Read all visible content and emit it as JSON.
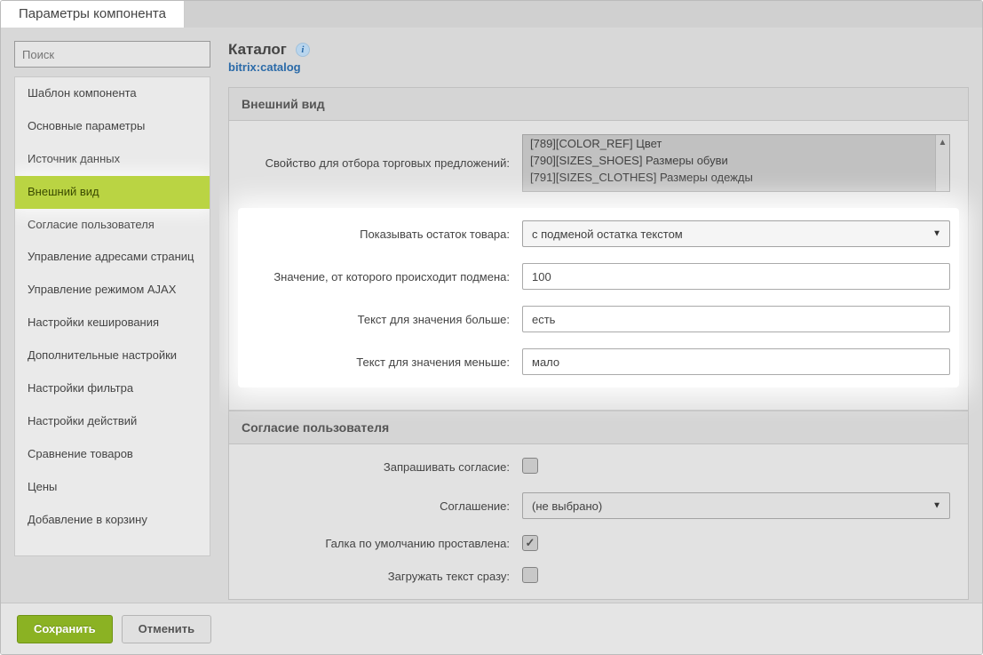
{
  "header": {
    "tab_title": "Параметры компонента"
  },
  "sidebar": {
    "search_placeholder": "Поиск",
    "items": [
      {
        "label": "Шаблон компонента"
      },
      {
        "label": "Основные параметры"
      },
      {
        "label": "Источник данных"
      },
      {
        "label": "Внешний вид",
        "active": true
      },
      {
        "label": "Согласие пользователя"
      },
      {
        "label": "Управление адресами страниц"
      },
      {
        "label": "Управление режимом AJAX"
      },
      {
        "label": "Настройки кеширования"
      },
      {
        "label": "Дополнительные настройки"
      },
      {
        "label": "Настройки фильтра"
      },
      {
        "label": "Настройки действий"
      },
      {
        "label": "Сравнение товаров"
      },
      {
        "label": "Цены"
      },
      {
        "label": "Добавление в корзину"
      }
    ]
  },
  "page": {
    "title": "Каталог",
    "component_name": "bitrix:catalog"
  },
  "section_appearance": {
    "title": "Внешний вид",
    "offer_prop_label": "Свойство для отбора торговых предложений:",
    "offer_prop_options": [
      "[789][COLOR_REF] Цвет",
      "[790][SIZES_SHOES] Размеры обуви",
      "[791][SIZES_CLOTHES] Размеры одежды"
    ],
    "show_remainder_label": "Показывать остаток товара:",
    "show_remainder_value": "с подменой остатка текстом",
    "threshold_label": "Значение, от которого происходит подмена:",
    "threshold_value": "100",
    "text_more_label": "Текст для значения больше:",
    "text_more_value": "есть",
    "text_less_label": "Текст для значения меньше:",
    "text_less_value": "мало"
  },
  "section_consent": {
    "title": "Согласие пользователя",
    "ask_label": "Запрашивать согласие:",
    "agreement_label": "Соглашение:",
    "agreement_value": "(не выбрано)",
    "default_label": "Галка по умолчанию проставлена:",
    "load_label": "Загружать текст сразу:"
  },
  "footer": {
    "save": "Сохранить",
    "cancel": "Отменить"
  }
}
